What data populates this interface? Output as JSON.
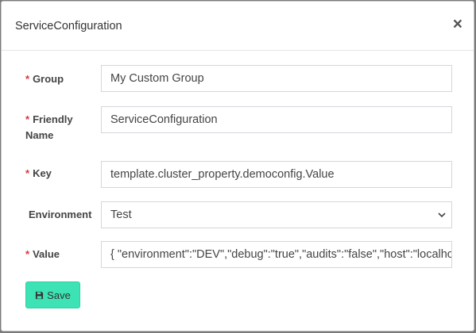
{
  "modal": {
    "title": "ServiceConfiguration",
    "close_symbol": "×"
  },
  "form": {
    "required_marker": "*",
    "group": {
      "label": "Group",
      "value": "My Custom Group"
    },
    "friendly_name": {
      "label_line1": "Friendly",
      "label_line2": "Name",
      "value": "ServiceConfiguration"
    },
    "key": {
      "label": "Key",
      "value": "template.cluster_property.democonfig.Value"
    },
    "environment": {
      "label": "Environment",
      "selected": "Test"
    },
    "value": {
      "label": "Value",
      "value": "{   \"environment\":\"DEV\",\"debug\":\"true\",\"audits\":\"false\",\"host\":\"localhost\""
    }
  },
  "actions": {
    "save_label": "Save"
  },
  "icons": {
    "close": "close-icon",
    "save": "floppy-disk-icon",
    "dropdown": "chevron-down-icon"
  }
}
